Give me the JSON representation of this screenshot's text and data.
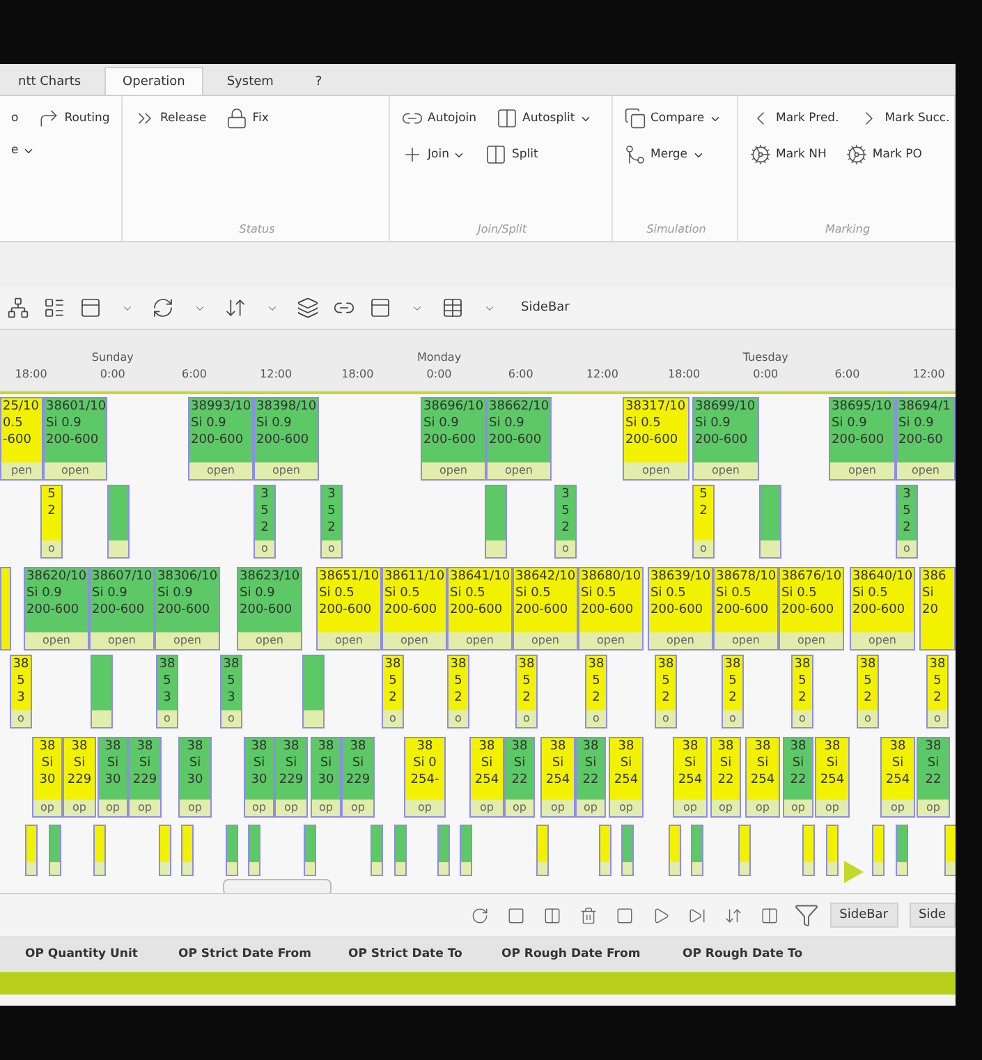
{
  "tabs": [
    {
      "label": "ntt Charts",
      "selected": false
    },
    {
      "label": "Operation",
      "selected": true
    },
    {
      "label": "System",
      "selected": false
    },
    {
      "label": "?",
      "selected": false
    }
  ],
  "ribbon": {
    "groups": [
      {
        "rows": [
          [
            {
              "label": "o",
              "dropdown": false
            },
            {
              "label": "Routing",
              "dropdown": false
            }
          ],
          [
            {
              "label": "e",
              "dropdown": true
            }
          ]
        ]
      },
      {
        "label": "Status",
        "rows": [
          [
            {
              "label": "Release",
              "dropdown": false
            },
            {
              "label": "Fix",
              "dropdown": false
            }
          ]
        ]
      },
      {
        "label": "Join/Split",
        "rows": [
          [
            {
              "label": "Autojoin",
              "dropdown": false
            },
            {
              "label": "Autosplit",
              "dropdown": true
            }
          ],
          [
            {
              "label": "Join",
              "dropdown": true
            },
            {
              "label": "Split",
              "dropdown": false
            }
          ]
        ]
      },
      {
        "label": "Simulation",
        "rows": [
          [
            {
              "label": "Compare",
              "dropdown": true
            }
          ],
          [
            {
              "label": "Merge",
              "dropdown": true
            }
          ]
        ]
      },
      {
        "label": "Marking",
        "rows": [
          [
            {
              "label": "Mark Pred.",
              "dropdown": false
            },
            {
              "label": "Mark Succ.",
              "dropdown": false
            }
          ],
          [
            {
              "label": "Mark NH",
              "dropdown": false
            },
            {
              "label": "Mark PO",
              "dropdown": false
            }
          ]
        ]
      }
    ]
  },
  "toolbar": {
    "sidebar_button": "SideBar"
  },
  "timeline": [
    {
      "label": "18:00"
    },
    {
      "label": "0:00",
      "day": "Sunday"
    },
    {
      "label": "6:00"
    },
    {
      "label": "12:00"
    },
    {
      "label": "18:00"
    },
    {
      "label": "0:00",
      "day": "Monday"
    },
    {
      "label": "6:00"
    },
    {
      "label": "12:00"
    },
    {
      "label": "18:00"
    },
    {
      "label": "0:00",
      "day": "Tuesday"
    },
    {
      "label": "6:00"
    },
    {
      "label": "12:00"
    }
  ],
  "gantt_rows": [
    {
      "kind": "card",
      "items": [
        {
          "color": "#f2f200",
          "lines": [
            "25/10",
            "0.5",
            "-600"
          ],
          "footer": "pen"
        },
        {
          "color": "#5cc866",
          "lines": [
            "38601/10",
            "Si 0.9",
            "200-600"
          ],
          "footer": "open"
        },
        {
          "color": "#5cc866",
          "lines": [
            "38993/10",
            "Si 0.9",
            "200-600"
          ],
          "footer": "open"
        },
        {
          "color": "#5cc866",
          "lines": [
            "38398/10",
            "Si 0.9",
            "200-600"
          ],
          "footer": "open"
        },
        {
          "color": "#5cc866",
          "lines": [
            "38696/10",
            "Si 0.9",
            "200-600"
          ],
          "footer": "open"
        },
        {
          "color": "#5cc866",
          "lines": [
            "38662/10",
            "Si 0.9",
            "200-600"
          ],
          "footer": "open"
        },
        {
          "color": "#f2f200",
          "lines": [
            "38317/10",
            "Si 0.5",
            "200-600"
          ],
          "footer": "open"
        },
        {
          "color": "#5cc866",
          "lines": [
            "38699/10",
            "Si 0.9",
            "200-600"
          ],
          "footer": "open"
        },
        {
          "color": "#5cc866",
          "lines": [
            "38695/10",
            "Si 0.9",
            "200-600"
          ],
          "footer": "open"
        },
        {
          "color": "#5cc866",
          "lines": [
            "38694/1",
            "Si 0.9",
            "200-60"
          ],
          "footer": "open"
        }
      ]
    },
    {
      "kind": "bar",
      "items": [
        {
          "color": "#f2f200",
          "lines": [
            "5",
            "2"
          ],
          "footer": "o"
        },
        {
          "color": "#5cc866"
        },
        {
          "color": "#5cc866",
          "lines": [
            "3",
            "5",
            "2"
          ],
          "footer": "o"
        },
        {
          "color": "#5cc866",
          "lines": [
            "3",
            "5",
            "2"
          ],
          "footer": "o"
        },
        {
          "color": "#5cc866"
        },
        {
          "color": "#5cc866",
          "lines": [
            "3",
            "5",
            "2"
          ],
          "footer": "o"
        },
        {
          "color": "#f2f200",
          "lines": [
            "5",
            "2"
          ],
          "footer": "o"
        },
        {
          "color": "#5cc866"
        },
        {
          "color": "#5cc866",
          "lines": [
            "3",
            "5",
            "2"
          ],
          "footer": "o"
        }
      ]
    },
    {
      "kind": "card",
      "items": [
        {
          "color": "#f2f200"
        },
        {
          "color": "#5cc866",
          "lines": [
            "38620/10",
            "Si 0.9",
            "200-600"
          ],
          "footer": "open"
        },
        {
          "color": "#5cc866",
          "lines": [
            "38607/10",
            "Si 0.9",
            "200-600"
          ],
          "footer": "open"
        },
        {
          "color": "#5cc866",
          "lines": [
            "38306/10",
            "Si 0.9",
            "200-600"
          ],
          "footer": "open"
        },
        {
          "color": "#5cc866",
          "lines": [
            "38623/10",
            "Si 0.9",
            "200-600"
          ],
          "footer": "open"
        },
        {
          "color": "#f2f200",
          "lines": [
            "38651/10",
            "Si 0.5",
            "200-600"
          ],
          "footer": "open"
        },
        {
          "color": "#f2f200",
          "lines": [
            "38611/10",
            "Si 0.5",
            "200-600"
          ],
          "footer": "open"
        },
        {
          "color": "#f2f200",
          "lines": [
            "38641/10",
            "Si 0.5",
            "200-600"
          ],
          "footer": "open"
        },
        {
          "color": "#f2f200",
          "lines": [
            "38642/10",
            "Si 0.5",
            "200-600"
          ],
          "footer": "open"
        },
        {
          "color": "#f2f200",
          "lines": [
            "38680/10",
            "Si 0.5",
            "200-600"
          ],
          "footer": "open"
        },
        {
          "color": "#f2f200",
          "lines": [
            "38639/10",
            "Si 0.5",
            "200-600"
          ],
          "footer": "open"
        },
        {
          "color": "#f2f200",
          "lines": [
            "38678/10",
            "Si 0.5",
            "200-600"
          ],
          "footer": "open"
        },
        {
          "color": "#f2f200",
          "lines": [
            "38676/10",
            "Si 0.5",
            "200-600"
          ],
          "footer": "open"
        },
        {
          "color": "#f2f200",
          "lines": [
            "38640/10",
            "Si 0.5",
            "200-600"
          ],
          "footer": "open"
        },
        {
          "color": "#f2f200",
          "lines": [
            "386",
            "Si",
            "20"
          ]
        }
      ]
    },
    {
      "kind": "bar",
      "items": [
        {
          "color": "#f2f200",
          "lines": [
            "38",
            "5",
            "3"
          ],
          "footer": "o"
        },
        {
          "color": "#5cc866"
        },
        {
          "color": "#5cc866",
          "lines": [
            "38",
            "5",
            "3"
          ],
          "footer": "o"
        },
        {
          "color": "#5cc866",
          "lines": [
            "38",
            "5",
            "3"
          ],
          "footer": "o"
        },
        {
          "color": "#5cc866"
        },
        {
          "color": "#f2f200",
          "lines": [
            "38",
            "5",
            "2"
          ],
          "footer": "o"
        },
        {
          "color": "#f2f200",
          "lines": [
            "38",
            "5",
            "2"
          ],
          "footer": "o"
        },
        {
          "color": "#f2f200",
          "lines": [
            "38",
            "5",
            "2"
          ],
          "footer": "o"
        },
        {
          "color": "#f2f200",
          "lines": [
            "38",
            "5",
            "2"
          ],
          "footer": "o"
        },
        {
          "color": "#f2f200",
          "lines": [
            "38",
            "5",
            "2"
          ],
          "footer": "o"
        },
        {
          "color": "#f2f200",
          "lines": [
            "38",
            "5",
            "2"
          ],
          "footer": "o"
        },
        {
          "color": "#f2f200",
          "lines": [
            "38",
            "5",
            "2"
          ],
          "footer": "o"
        },
        {
          "color": "#f2f200",
          "lines": [
            "38",
            "5",
            "2"
          ],
          "footer": "o"
        },
        {
          "color": "#f2f200",
          "lines": [
            "38",
            "5",
            "2"
          ],
          "footer": "o"
        }
      ]
    },
    {
      "kind": "slim",
      "items": [
        {
          "color": "#f2f200",
          "lines": [
            "38",
            "Si",
            "30"
          ],
          "footer": "op"
        },
        {
          "color": "#f2f200",
          "lines": [
            "38",
            "Si",
            "229"
          ],
          "footer": "op"
        },
        {
          "color": "#5cc866",
          "lines": [
            "38",
            "Si",
            "30"
          ],
          "footer": "op"
        },
        {
          "color": "#5cc866",
          "lines": [
            "38",
            "Si",
            "229"
          ],
          "footer": "op"
        },
        {
          "color": "#5cc866",
          "lines": [
            "38",
            "Si",
            "30"
          ],
          "footer": "op"
        },
        {
          "color": "#5cc866",
          "lines": [
            "38",
            "Si",
            "30"
          ],
          "footer": "op"
        },
        {
          "color": "#5cc866",
          "lines": [
            "38",
            "Si",
            "229"
          ],
          "footer": "op"
        },
        {
          "color": "#5cc866",
          "lines": [
            "38",
            "Si",
            "30"
          ],
          "footer": "op"
        },
        {
          "color": "#5cc866",
          "lines": [
            "38",
            "Si",
            "229"
          ],
          "footer": "op"
        },
        {
          "color": "#f2f200",
          "lines": [
            "38",
            "Si 0",
            "254-"
          ],
          "footer": "op"
        },
        {
          "color": "#f2f200",
          "lines": [
            "38",
            "Si",
            "254"
          ],
          "footer": "op"
        },
        {
          "color": "#5cc866",
          "lines": [
            "38",
            "Si",
            "22"
          ],
          "footer": "op"
        },
        {
          "color": "#f2f200",
          "lines": [
            "38",
            "Si",
            "254"
          ],
          "footer": "op"
        },
        {
          "color": "#5cc866",
          "lines": [
            "38",
            "Si",
            "22"
          ],
          "footer": "op"
        },
        {
          "color": "#f2f200",
          "lines": [
            "38",
            "Si",
            "254"
          ],
          "footer": "op"
        },
        {
          "color": "#f2f200",
          "lines": [
            "38",
            "Si",
            "254"
          ],
          "footer": "op"
        },
        {
          "color": "#f2f200",
          "lines": [
            "38",
            "Si",
            "22"
          ],
          "footer": "op"
        },
        {
          "color": "#f2f200",
          "lines": [
            "38",
            "Si",
            "254"
          ],
          "footer": "op"
        },
        {
          "color": "#5cc866",
          "lines": [
            "38",
            "Si",
            "22"
          ],
          "footer": "op"
        },
        {
          "color": "#f2f200",
          "lines": [
            "38",
            "Si",
            "254"
          ],
          "footer": "op"
        },
        {
          "color": "#f2f200",
          "lines": [
            "38",
            "Si",
            "254"
          ],
          "footer": "op"
        },
        {
          "color": "#5cc866",
          "lines": [
            "38",
            "Si",
            "22"
          ],
          "footer": "op"
        }
      ]
    },
    {
      "kind": "thin",
      "items": [
        {
          "color": "#f2f200"
        },
        {
          "color": "#5cc866"
        },
        {
          "color": "#f2f200"
        },
        {
          "color": "#f2f200"
        },
        {
          "color": "#f2f200"
        },
        {
          "color": "#5cc866"
        },
        {
          "color": "#5cc866"
        },
        {
          "color": "#5cc866"
        },
        {
          "color": "#5cc866"
        },
        {
          "color": "#5cc866"
        },
        {
          "color": "#5cc866"
        },
        {
          "color": "#5cc866"
        },
        {
          "color": "#f2f200"
        },
        {
          "color": "#f2f200"
        },
        {
          "color": "#5cc866"
        },
        {
          "color": "#f2f200"
        },
        {
          "color": "#5cc866"
        },
        {
          "color": "#f2f200"
        },
        {
          "color": "#f2f200"
        },
        {
          "color": "#f2f200"
        },
        {
          "color": "#f2f200"
        },
        {
          "color": "#5cc866"
        },
        {
          "color": "#f2f200"
        }
      ]
    }
  ],
  "bottom_toolbar": {
    "buttons": [
      {
        "label": "SideBar"
      },
      {
        "label": "Side"
      }
    ]
  },
  "table": {
    "columns": [
      "OP Quantity Unit",
      "OP Strict Date From",
      "OP Strict Date To",
      "OP Rough Date From",
      "OP Rough Date To"
    ]
  }
}
